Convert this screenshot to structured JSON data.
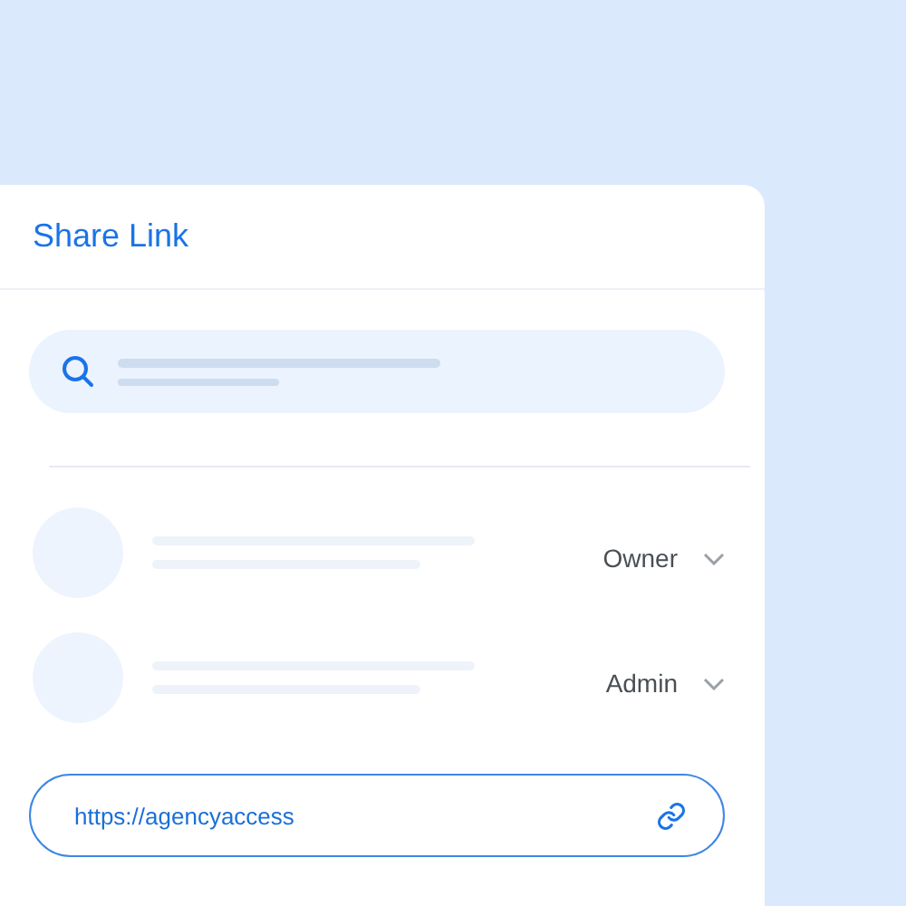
{
  "panel": {
    "title": "Share Link"
  },
  "members": [
    {
      "role": "Owner"
    },
    {
      "role": "Admin"
    }
  ],
  "link": {
    "value": "https://agencyaccess"
  }
}
